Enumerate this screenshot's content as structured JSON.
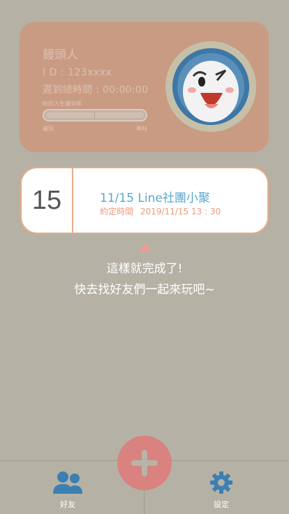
{
  "profile": {
    "name": "饅頭人",
    "id_text": "I D : 123xxxx",
    "late_total": "遲到總時間 : 00:00:00",
    "late_rate_title": "你的人生遲到率",
    "label_late": "遲到",
    "label_ontime": "準時",
    "avatar_icon": "line-character-avatar-icon"
  },
  "event": {
    "day": "15",
    "title": "11/15 Line社團小聚",
    "time_label": "約定時間",
    "time_value": "2019/11/15  13 : 30"
  },
  "hint": {
    "line1": "這樣就完成了!",
    "line2": "快去找好友們一起來玩吧~"
  },
  "tabbar": {
    "friends_label": "好友",
    "settings_label": "設定",
    "add_icon": "plus-icon"
  },
  "colors": {
    "background": "#b5b2a5",
    "profile_card": "#c99b83",
    "accent_blue": "#5aa7cc",
    "accent_orange": "#ec9a7d",
    "add_button": "#d98280"
  }
}
